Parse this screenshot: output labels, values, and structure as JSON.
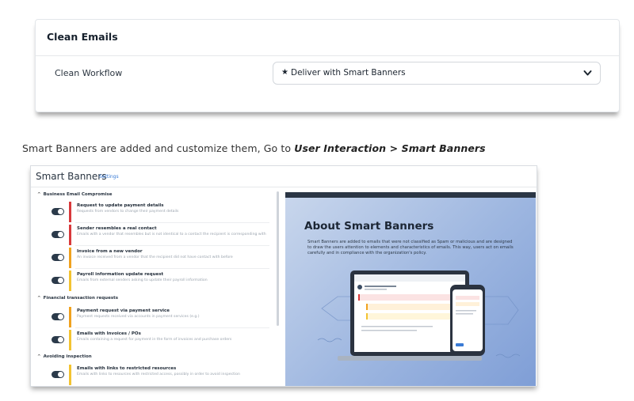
{
  "clean_emails": {
    "title": "Clean Emails",
    "workflow_label": "Clean Workflow",
    "workflow_value": "Deliver with Smart Banners",
    "workflow_icon": "star-icon"
  },
  "instruction": {
    "text": "Smart Banners are added and customize them, Go to ",
    "path": "User Interaction > Smart Banners"
  },
  "smart_banners": {
    "title": "Smart Banners",
    "settings_link": "Settings",
    "groups": [
      {
        "label": "Business Email Compromise",
        "items": [
          {
            "title": "Request to update payment details",
            "desc": "Requests from vendors to change their payment details",
            "severity": "red"
          },
          {
            "title": "Sender resembles a real contact",
            "desc": "Emails with a vendor that resembles but is not identical to a contact the recipient is corresponding with",
            "severity": "red"
          },
          {
            "title": "Invoice from a new vendor",
            "desc": "An invoice received from a vendor that the recipient did not have contact with before",
            "severity": "orange"
          },
          {
            "title": "Payroll information update request",
            "desc": "Emails from external senders asking to update their payroll information",
            "severity": "yellow"
          }
        ]
      },
      {
        "label": "Financial transaction requests",
        "items": [
          {
            "title": "Payment request via payment service",
            "desc": "Payment requests received via accounts in payment services (e.g.)",
            "severity": "orange"
          },
          {
            "title": "Emails with Invoices / POs",
            "desc": "Emails containing a request for payment in the form of invoices and purchase orders",
            "severity": "yellow"
          }
        ]
      },
      {
        "label": "Avoiding inspection",
        "items": [
          {
            "title": "Emails with links to restricted resources",
            "desc": "Emails with links to resources with restricted access, possibly in order to avoid inspection",
            "severity": "yellow"
          }
        ]
      }
    ],
    "about": {
      "title": "About Smart Banners",
      "description": "Smart Banners are added to emails that were not classified as Spam or malicious and are designed to draw the users attention to elements and characteristics of emails. This way, users act on emails carefully and in compliance with the organization's policy."
    }
  },
  "colors": {
    "red": "#d8393b",
    "orange": "#f0a21f",
    "yellow": "#f3c331",
    "link": "#3a7bd5"
  }
}
